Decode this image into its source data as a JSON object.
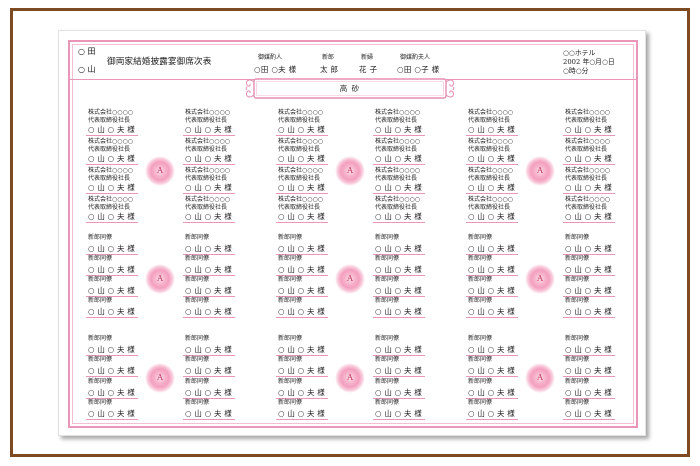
{
  "header": {
    "families": [
      "○ 田",
      "○ 山"
    ],
    "title": "御両家結婚披露宴御席次表",
    "party": [
      {
        "role": "御媒酌人",
        "name": "○田 ○夫 様"
      },
      {
        "role": "新郎",
        "name": "太 郎"
      },
      {
        "role": "新婦",
        "name": "花 子"
      },
      {
        "role": "御媒酌夫人",
        "name": "○田 ○子 様"
      }
    ],
    "venue": "○○ホテル",
    "date": "2002 年○月○日",
    "time": "○時○分"
  },
  "head_table": "高 砂",
  "colors": {
    "frame": "#7d4a21",
    "accent": "#ea96b8",
    "accent_light": "#f4bfd4",
    "table_label": "#c2305c"
  },
  "tables": [
    {
      "label": "A",
      "left": [
        {
          "company": "株式会社○○○○",
          "title": "代表取締役社長",
          "name": "○ 山 ○ 夫 様"
        },
        {
          "company": "株式会社○○○○",
          "title": "代表取締役社長",
          "name": "○ 山 ○ 夫 様"
        },
        {
          "company": "株式会社○○○○",
          "title": "代表取締役社長",
          "name": "○ 山 ○ 夫 様"
        },
        {
          "company": "株式会社○○○○",
          "title": "代表取締役社長",
          "name": "○ 山 ○ 夫 様"
        }
      ],
      "right": [
        {
          "company": "株式会社○○○○",
          "title": "代表取締役社長",
          "name": "○ 山 ○ 夫 様"
        },
        {
          "company": "株式会社○○○○",
          "title": "代表取締役社長",
          "name": "○ 山 ○ 夫 様"
        },
        {
          "company": "株式会社○○○○",
          "title": "代表取締役社長",
          "name": "○ 山 ○ 夫 様"
        },
        {
          "company": "株式会社○○○○",
          "title": "代表取締役社長",
          "name": "○ 山 ○ 夫 様"
        }
      ]
    },
    {
      "label": "A",
      "left": [
        {
          "company": "株式会社○○○○",
          "title": "代表取締役社長",
          "name": "○ 山 ○ 夫 様"
        },
        {
          "company": "株式会社○○○○",
          "title": "代表取締役社長",
          "name": "○ 山 ○ 夫 様"
        },
        {
          "company": "株式会社○○○○",
          "title": "代表取締役社長",
          "name": "○ 山 ○ 夫 様"
        },
        {
          "company": "株式会社○○○○",
          "title": "代表取締役社長",
          "name": "○ 山 ○ 夫 様"
        }
      ],
      "right": [
        {
          "company": "株式会社○○○○",
          "title": "代表取締役社長",
          "name": "○ 山 ○ 夫 様"
        },
        {
          "company": "株式会社○○○○",
          "title": "代表取締役社長",
          "name": "○ 山 ○ 夫 様"
        },
        {
          "company": "株式会社○○○○",
          "title": "代表取締役社長",
          "name": "○ 山 ○ 夫 様"
        },
        {
          "company": "株式会社○○○○",
          "title": "代表取締役社長",
          "name": "○ 山 ○ 夫 様"
        }
      ]
    },
    {
      "label": "A",
      "left": [
        {
          "company": "株式会社○○○○",
          "title": "代表取締役社長",
          "name": "○ 山 ○ 夫 様"
        },
        {
          "company": "株式会社○○○○",
          "title": "代表取締役社長",
          "name": "○ 山 ○ 夫 様"
        },
        {
          "company": "株式会社○○○○",
          "title": "代表取締役社長",
          "name": "○ 山 ○ 夫 様"
        },
        {
          "company": "株式会社○○○○",
          "title": "代表取締役社長",
          "name": "○ 山 ○ 夫 様"
        }
      ],
      "right": [
        {
          "company": "株式会社○○○○",
          "title": "代表取締役社長",
          "name": "○ 山 ○ 夫 様"
        },
        {
          "company": "株式会社○○○○",
          "title": "代表取締役社長",
          "name": "○ 山 ○ 夫 様"
        },
        {
          "company": "株式会社○○○○",
          "title": "代表取締役社長",
          "name": "○ 山 ○ 夫 様"
        },
        {
          "company": "株式会社○○○○",
          "title": "代表取締役社長",
          "name": "○ 山 ○ 夫 様"
        }
      ]
    },
    {
      "label": "A",
      "left": [
        {
          "relation": "新郎同僚",
          "name": "○ 山 ○ 夫 様"
        },
        {
          "relation": "新郎同僚",
          "name": "○ 山 ○ 夫 様"
        },
        {
          "relation": "新郎同僚",
          "name": "○ 山 ○ 夫 様"
        },
        {
          "relation": "新郎同僚",
          "name": "○ 山 ○ 夫 様"
        }
      ],
      "right": [
        {
          "relation": "新郎同僚",
          "name": "○ 山 ○ 夫 様"
        },
        {
          "relation": "新郎同僚",
          "name": "○ 山 ○ 夫 様"
        },
        {
          "relation": "新郎同僚",
          "name": "○ 山 ○ 夫 様"
        },
        {
          "relation": "新郎同僚",
          "name": "○ 山 ○ 夫 様"
        }
      ]
    },
    {
      "label": "A",
      "left": [
        {
          "relation": "新郎同僚",
          "name": "○ 山 ○ 夫 様"
        },
        {
          "relation": "新郎同僚",
          "name": "○ 山 ○ 夫 様"
        },
        {
          "relation": "新郎同僚",
          "name": "○ 山 ○ 夫 様"
        },
        {
          "relation": "新郎同僚",
          "name": "○ 山 ○ 夫 様"
        }
      ],
      "right": [
        {
          "relation": "新郎同僚",
          "name": "○ 山 ○ 夫 様"
        },
        {
          "relation": "新郎同僚",
          "name": "○ 山 ○ 夫 様"
        },
        {
          "relation": "新郎同僚",
          "name": "○ 山 ○ 夫 様"
        },
        {
          "relation": "新郎同僚",
          "name": "○ 山 ○ 夫 様"
        }
      ]
    },
    {
      "label": "A",
      "left": [
        {
          "relation": "新郎同僚",
          "name": "○ 山 ○ 夫 様"
        },
        {
          "relation": "新郎同僚",
          "name": "○ 山 ○ 夫 様"
        },
        {
          "relation": "新郎同僚",
          "name": "○ 山 ○ 夫 様"
        },
        {
          "relation": "新郎同僚",
          "name": "○ 山 ○ 夫 様"
        }
      ],
      "right": [
        {
          "relation": "新郎同僚",
          "name": "○ 山 ○ 夫 様"
        },
        {
          "relation": "新郎同僚",
          "name": "○ 山 ○ 夫 様"
        },
        {
          "relation": "新郎同僚",
          "name": "○ 山 ○ 夫 様"
        },
        {
          "relation": "新郎同僚",
          "name": "○ 山 ○ 夫 様"
        }
      ]
    },
    {
      "label": "A",
      "left": [
        {
          "relation": "新郎同僚",
          "name": "○ 山 ○ 夫 様"
        },
        {
          "relation": "新郎同僚",
          "name": "○ 山 ○ 夫 様"
        },
        {
          "relation": "新郎同僚",
          "name": "○ 山 ○ 夫 様"
        },
        {
          "relation": "新郎同僚",
          "name": "○ 山 ○ 夫 様"
        }
      ],
      "right": [
        {
          "relation": "新郎同僚",
          "name": "○ 山 ○ 夫 様"
        },
        {
          "relation": "新郎同僚",
          "name": "○ 山 ○ 夫 様"
        },
        {
          "relation": "新郎同僚",
          "name": "○ 山 ○ 夫 様"
        },
        {
          "relation": "新郎同僚",
          "name": "○ 山 ○ 夫 様"
        }
      ]
    },
    {
      "label": "A",
      "left": [
        {
          "relation": "新郎同僚",
          "name": "○ 山 ○ 夫 様"
        },
        {
          "relation": "新郎同僚",
          "name": "○ 山 ○ 夫 様"
        },
        {
          "relation": "新郎同僚",
          "name": "○ 山 ○ 夫 様"
        },
        {
          "relation": "新郎同僚",
          "name": "○ 山 ○ 夫 様"
        }
      ],
      "right": [
        {
          "relation": "新郎同僚",
          "name": "○ 山 ○ 夫 様"
        },
        {
          "relation": "新郎同僚",
          "name": "○ 山 ○ 夫 様"
        },
        {
          "relation": "新郎同僚",
          "name": "○ 山 ○ 夫 様"
        },
        {
          "relation": "新郎同僚",
          "name": "○ 山 ○ 夫 様"
        }
      ]
    },
    {
      "label": "A",
      "left": [
        {
          "relation": "新郎同僚",
          "name": "○ 山 ○ 夫 様"
        },
        {
          "relation": "新郎同僚",
          "name": "○ 山 ○ 夫 様"
        },
        {
          "relation": "新郎同僚",
          "name": "○ 山 ○ 夫 様"
        },
        {
          "relation": "新郎同僚",
          "name": "○ 山 ○ 夫 様"
        }
      ],
      "right": [
        {
          "relation": "新郎同僚",
          "name": "○ 山 ○ 夫 様"
        },
        {
          "relation": "新郎同僚",
          "name": "○ 山 ○ 夫 様"
        },
        {
          "relation": "新郎同僚",
          "name": "○ 山 ○ 夫 様"
        },
        {
          "relation": "新郎同僚",
          "name": "○ 山 ○ 夫 様"
        }
      ]
    }
  ]
}
